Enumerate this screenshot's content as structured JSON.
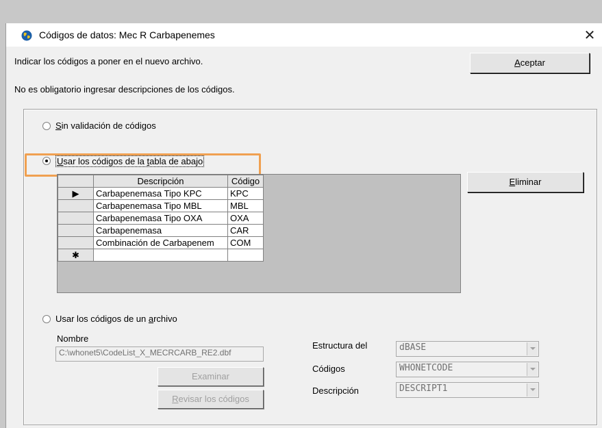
{
  "window": {
    "title": "Códigos de datos: Mec R Carbapenemes",
    "close_symbol": "✕"
  },
  "info": {
    "line1": "Indicar los códigos a poner en el nuevo archivo.",
    "line2": "No es obligatorio ingresar descripciones de los códigos."
  },
  "buttons": {
    "accept_prefix": "A",
    "accept_rest": "ceptar",
    "delete_prefix": "E",
    "delete_rest": "liminar",
    "browse": "Examinar",
    "review_prefix": "R",
    "review_rest": "evisar los códigos"
  },
  "options": {
    "no_validation_u": "S",
    "no_validation_rest": "in validación de códigos",
    "use_table_u": "U",
    "use_table_mid": "sar los códigos de la ",
    "use_table_u2": "t",
    "use_table_rest": "abla de abajo",
    "use_file_pre": "Usar los códigos de un ",
    "use_file_u": "a",
    "use_file_rest": "rchivo",
    "selected": "use_table"
  },
  "table": {
    "headers": [
      "Descripción",
      "Código"
    ],
    "current_row_marker": "▶",
    "new_row_marker": "✱",
    "rows": [
      {
        "description": "Carbapenemasa Tipo KPC",
        "code": "KPC"
      },
      {
        "description": "Carbapenemasa Tipo MBL",
        "code": "MBL"
      },
      {
        "description": "Carbapenemasa Tipo OXA",
        "code": "OXA"
      },
      {
        "description": "Carbapenemasa",
        "code": "CAR"
      },
      {
        "description": "Combinación de Carbapenem",
        "code": "COM"
      }
    ]
  },
  "file": {
    "name_label": "Nombre",
    "name_value": "C:\\whonet5\\CodeList_X_MECRCARB_RE2.dbf",
    "structure_label": "Estructura del",
    "structure_value": "dBASE",
    "codes_label": "Códigos",
    "codes_value": "WHONETCODE",
    "description_label": "Descripción",
    "description_value": "DESCRIPT1"
  },
  "colors": {
    "highlight": "#f0a050",
    "grid_background": "#c0c0c0"
  }
}
